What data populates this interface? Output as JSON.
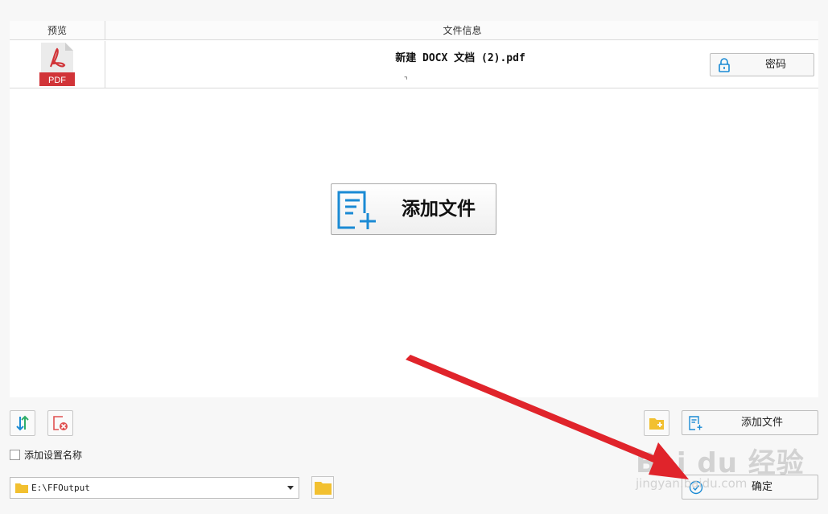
{
  "table": {
    "col_preview": "预览",
    "col_info": "文件信息",
    "rows": [
      {
        "thumb_label": "PDF",
        "filename": "新建 DOCX 文档 (2).pdf",
        "password_label": "密码"
      }
    ]
  },
  "main": {
    "add_file_label": "添加文件"
  },
  "toolbar": {
    "add_file_label": "添加文件",
    "confirm_label": "确定"
  },
  "options": {
    "add_setting_name_label": "添加设置名称",
    "add_setting_name_checked": false
  },
  "output": {
    "path": "E:\\FFOutput"
  },
  "watermark": {
    "brand": "Bai du 经验",
    "url": "jingyan.baidu.com"
  },
  "colors": {
    "accent_blue": "#1a8ad4",
    "pdf_red": "#d13438",
    "folder_yellow": "#f2c030",
    "arrow_red": "#e0242b"
  }
}
